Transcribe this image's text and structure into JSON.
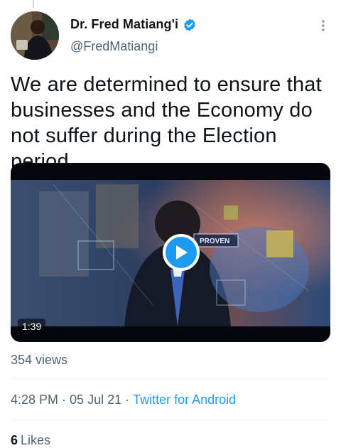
{
  "author": {
    "display_name": "Dr. Fred Matiang'i",
    "handle": "@FredMatiangi",
    "verified": true
  },
  "tweet": {
    "text": "We are determined to ensure that businesses and the Economy do not suffer during the Election period..."
  },
  "media": {
    "duration": "1:39",
    "overlay_text": "PROVEN",
    "icon": "play-icon"
  },
  "stats": {
    "views": "354 views",
    "time": "4:28 PM",
    "date": "05 Jul 21",
    "source": "Twitter for Android",
    "likes_count": "6",
    "likes_label": "Likes"
  },
  "colors": {
    "accent": "#1d9bf0",
    "text_primary": "#0f1419",
    "text_secondary": "#536471"
  }
}
